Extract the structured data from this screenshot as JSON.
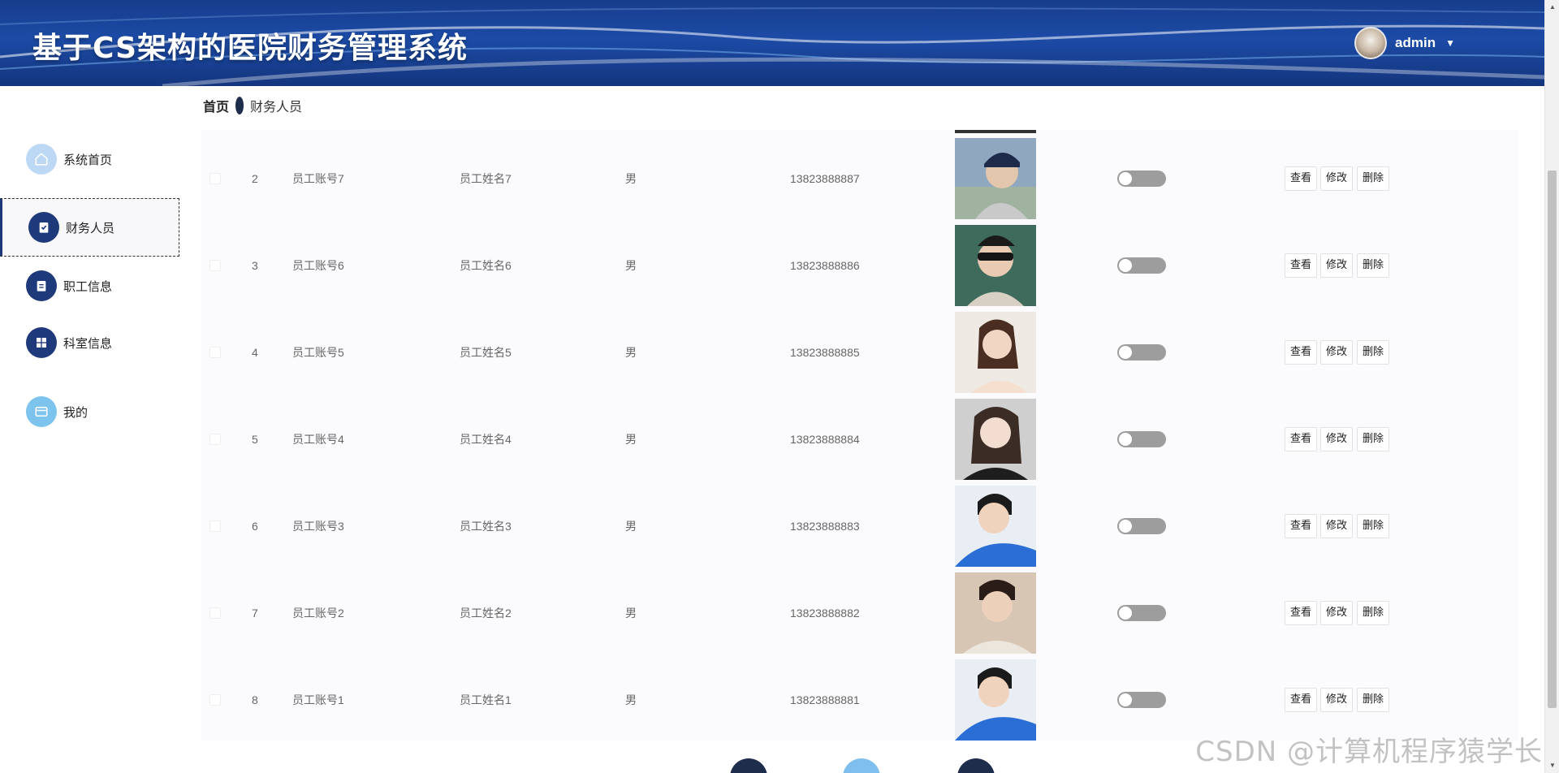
{
  "header": {
    "title": "基于CS架构的医院财务管理系统",
    "username": "admin",
    "caret_icon": "caret-down-icon"
  },
  "breadcrumb": {
    "home": "首页",
    "current": "财务人员"
  },
  "sidebar": {
    "items": [
      {
        "label": "系统首页",
        "icon": "home-icon",
        "active": false
      },
      {
        "label": "财务人员",
        "icon": "clipboard-check-icon",
        "active": true
      },
      {
        "label": "职工信息",
        "icon": "clipboard-icon",
        "active": false
      },
      {
        "label": "科室信息",
        "icon": "grid-icon",
        "active": false
      },
      {
        "label": "我的",
        "icon": "card-icon",
        "active": false
      }
    ]
  },
  "table": {
    "rows": [
      {
        "index": "2",
        "account": "员工账号7",
        "name": "员工姓名7",
        "gender": "男",
        "phone": "13823888887"
      },
      {
        "index": "3",
        "account": "员工账号6",
        "name": "员工姓名6",
        "gender": "男",
        "phone": "13823888886"
      },
      {
        "index": "4",
        "account": "员工账号5",
        "name": "员工姓名5",
        "gender": "男",
        "phone": "13823888885"
      },
      {
        "index": "5",
        "account": "员工账号4",
        "name": "员工姓名4",
        "gender": "男",
        "phone": "13823888884"
      },
      {
        "index": "6",
        "account": "员工账号3",
        "name": "员工姓名3",
        "gender": "男",
        "phone": "13823888883"
      },
      {
        "index": "7",
        "account": "员工账号2",
        "name": "员工姓名2",
        "gender": "男",
        "phone": "13823888882"
      },
      {
        "index": "8",
        "account": "员工账号1",
        "name": "员工姓名1",
        "gender": "男",
        "phone": "13823888881"
      }
    ],
    "actions": {
      "view": "查看",
      "edit": "修改",
      "delete": "删除"
    }
  },
  "watermark": "CSDN @计算机程序猿学长",
  "colors": {
    "header_bg": "#1c4ba6",
    "accent": "#1f3a7a",
    "light_accent": "#bcd8f5",
    "toggle_off": "#9d9d9d"
  }
}
